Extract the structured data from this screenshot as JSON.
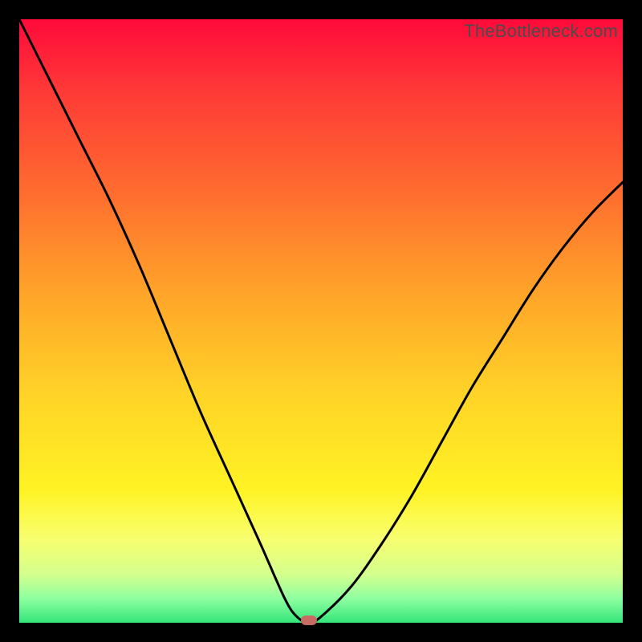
{
  "watermark": "TheBottleneck.com",
  "chart_data": {
    "type": "line",
    "title": "",
    "xlabel": "",
    "ylabel": "",
    "xlim": [
      0,
      100
    ],
    "ylim": [
      0,
      100
    ],
    "grid": false,
    "legend": false,
    "series": [
      {
        "name": "bottleneck-curve",
        "x": [
          0,
          5,
          10,
          15,
          20,
          25,
          30,
          35,
          40,
          44,
          46,
          48,
          50,
          55,
          60,
          65,
          70,
          75,
          80,
          85,
          90,
          95,
          100
        ],
        "y": [
          100,
          90,
          80,
          70,
          59,
          47,
          35,
          24,
          13,
          4,
          1,
          0,
          1,
          6,
          13,
          21,
          30,
          39,
          47,
          55,
          62,
          68,
          73
        ]
      }
    ],
    "annotations": [
      {
        "name": "optimal-point",
        "x": 48,
        "y": 0
      }
    ],
    "background_gradient": {
      "direction": "vertical",
      "stops": [
        {
          "pos": 0.0,
          "color": "#ff0a3a"
        },
        {
          "pos": 0.45,
          "color": "#ffa329"
        },
        {
          "pos": 0.78,
          "color": "#fff324"
        },
        {
          "pos": 1.0,
          "color": "#34e57a"
        }
      ]
    }
  }
}
